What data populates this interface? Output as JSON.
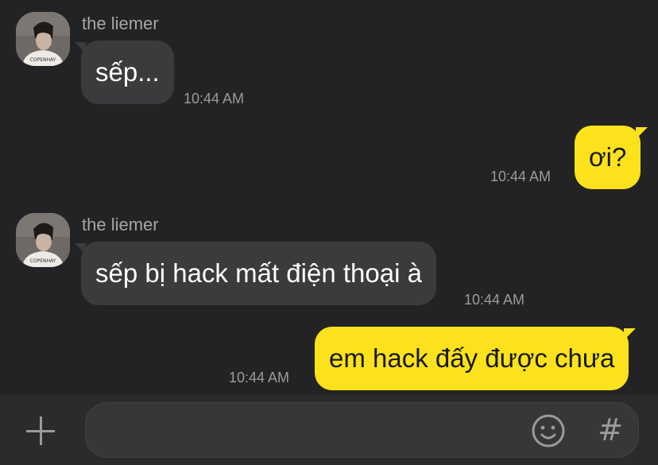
{
  "messages": [
    {
      "type": "incoming",
      "sender": "the liemer",
      "text": "sếp...",
      "time": "10:44 AM"
    },
    {
      "type": "outgoing",
      "text": "ơi?",
      "time": "10:44 AM"
    },
    {
      "type": "incoming",
      "sender": "the liemer",
      "text": "sếp bị hack mất điện thoại à",
      "time": "10:44 AM"
    },
    {
      "type": "outgoing",
      "text": "em hack đấy được chưa",
      "time": "10:44 AM"
    }
  ],
  "avatar": {
    "shirt_text": "COPENHAY"
  },
  "composer": {
    "plus_icon": "plus-icon",
    "emoji_icon": "emoji-icon",
    "hashtag_icon": "#"
  },
  "colors": {
    "background": "#232325",
    "incoming_bubble": "#3b3b3e",
    "outgoing_bubble": "#fbe21c",
    "timestamp": "#9b9b9d"
  }
}
